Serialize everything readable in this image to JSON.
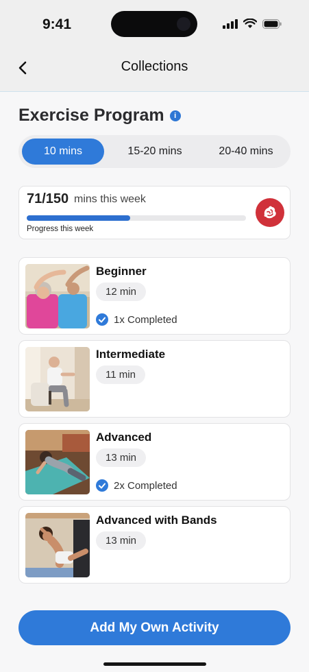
{
  "status_bar": {
    "time": "9:41",
    "icons": [
      "cellular-signal-icon",
      "wifi-icon",
      "battery-icon"
    ]
  },
  "nav": {
    "title": "Collections",
    "back_icon": "chevron-left-icon"
  },
  "program": {
    "title": "Exercise Program",
    "info_icon": "info-icon"
  },
  "duration_tabs": [
    {
      "label": "10 mins",
      "selected": true
    },
    {
      "label": "15-20 mins",
      "selected": false
    },
    {
      "label": "20-40 mins",
      "selected": false
    }
  ],
  "weekly_progress": {
    "value_text": "71/150",
    "suffix": "mins this week",
    "caption": "Progress this week",
    "completed_minutes": 71,
    "goal_minutes": 150,
    "badge_icon": "muscle-icon"
  },
  "programs": [
    {
      "name": "Beginner",
      "duration": "12 min",
      "completed": "1x Completed",
      "thumbnail": "seniors-stretching-photo"
    },
    {
      "name": "Intermediate",
      "duration": "11 min",
      "completed": "",
      "thumbnail": "chair-exercise-photo"
    },
    {
      "name": "Advanced",
      "duration": "13 min",
      "completed": "2x Completed",
      "thumbnail": "yoga-mat-stretch-photo"
    },
    {
      "name": "Advanced with Bands",
      "duration": "13 min",
      "completed": "",
      "thumbnail": "situp-workout-photo"
    }
  ],
  "actions": {
    "add_activity": "Add My Own Activity"
  },
  "colors": {
    "accent": "#2f7ad9",
    "progress_fill": "#2d6fcf",
    "badge_red": "#d0313a",
    "header_bg": "#efefef",
    "page_bg": "#f7f7f8"
  }
}
